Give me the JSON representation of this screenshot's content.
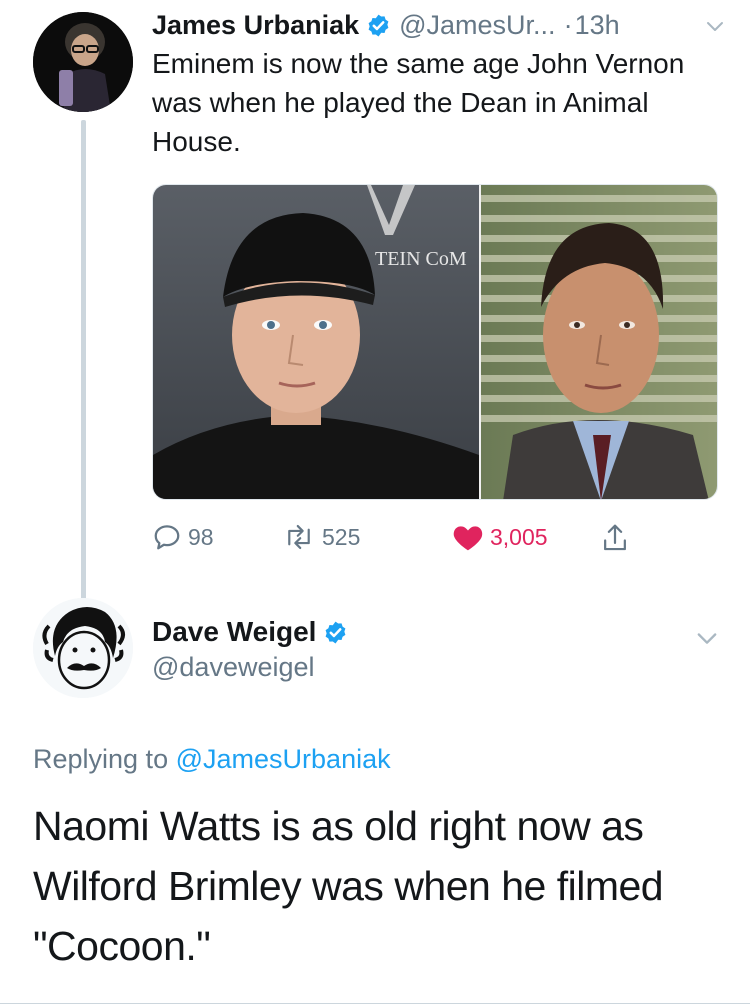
{
  "colors": {
    "accent": "#1da1f2",
    "like": "#e0245e",
    "secondary_text": "#657786",
    "primary_text": "#14171a"
  },
  "tweet1": {
    "display_name": "James Urbaniak",
    "handle": "@JamesUr...",
    "dot": "·",
    "time": "13h",
    "text": "Eminem is now the same age John Vernon was when he played the Dean in Animal House.",
    "media_text": "TEIN CoM",
    "icons": [
      "verified-badge-icon",
      "chevron-down-icon",
      "reply-icon",
      "retweet-icon",
      "heart-icon",
      "share-icon"
    ],
    "stats": {
      "replies": "98",
      "retweets": "525",
      "likes": "3,005"
    }
  },
  "tweet2": {
    "display_name": "Dave Weigel",
    "handle": "@daveweigel",
    "replying_prefix": "Replying to",
    "replying_to": "@JamesUrbaniak",
    "text": "Naomi Watts is as old right now as Wilford Brimley was when he filmed \"Cocoon.\""
  }
}
